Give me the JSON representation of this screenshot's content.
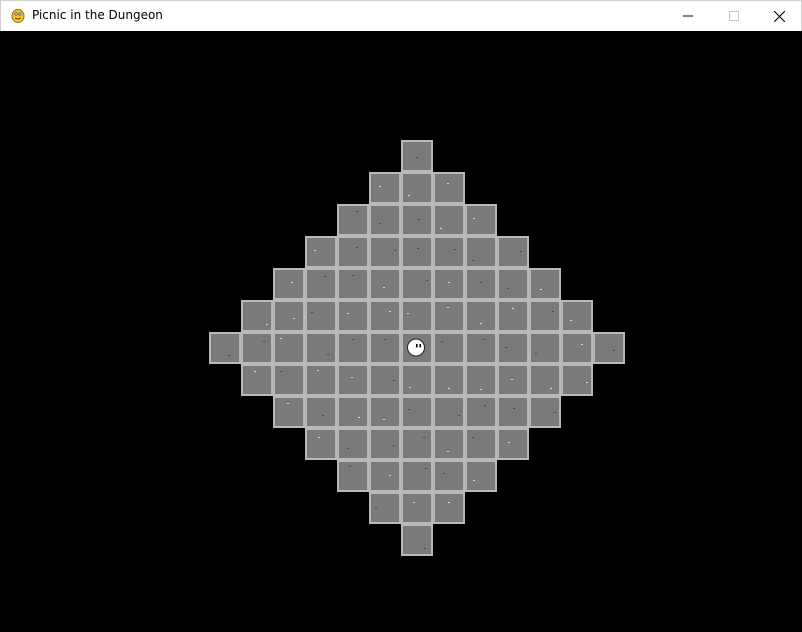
{
  "window": {
    "title": "Picnic in the Dungeon",
    "icon": "pygame-snake-icon"
  },
  "controls": {
    "minimize_icon": "minimize-icon",
    "maximize_icon": "maximize-icon",
    "close_icon": "close-icon"
  },
  "game": {
    "background_color": "#000000",
    "floor_color": "#7a7a7a",
    "floor_border_color": "#b8b8b8",
    "map_shape": "diamond",
    "map_radius": 6,
    "player": {
      "grid_col": 0,
      "grid_row": 0,
      "color": "#ffffff"
    }
  }
}
